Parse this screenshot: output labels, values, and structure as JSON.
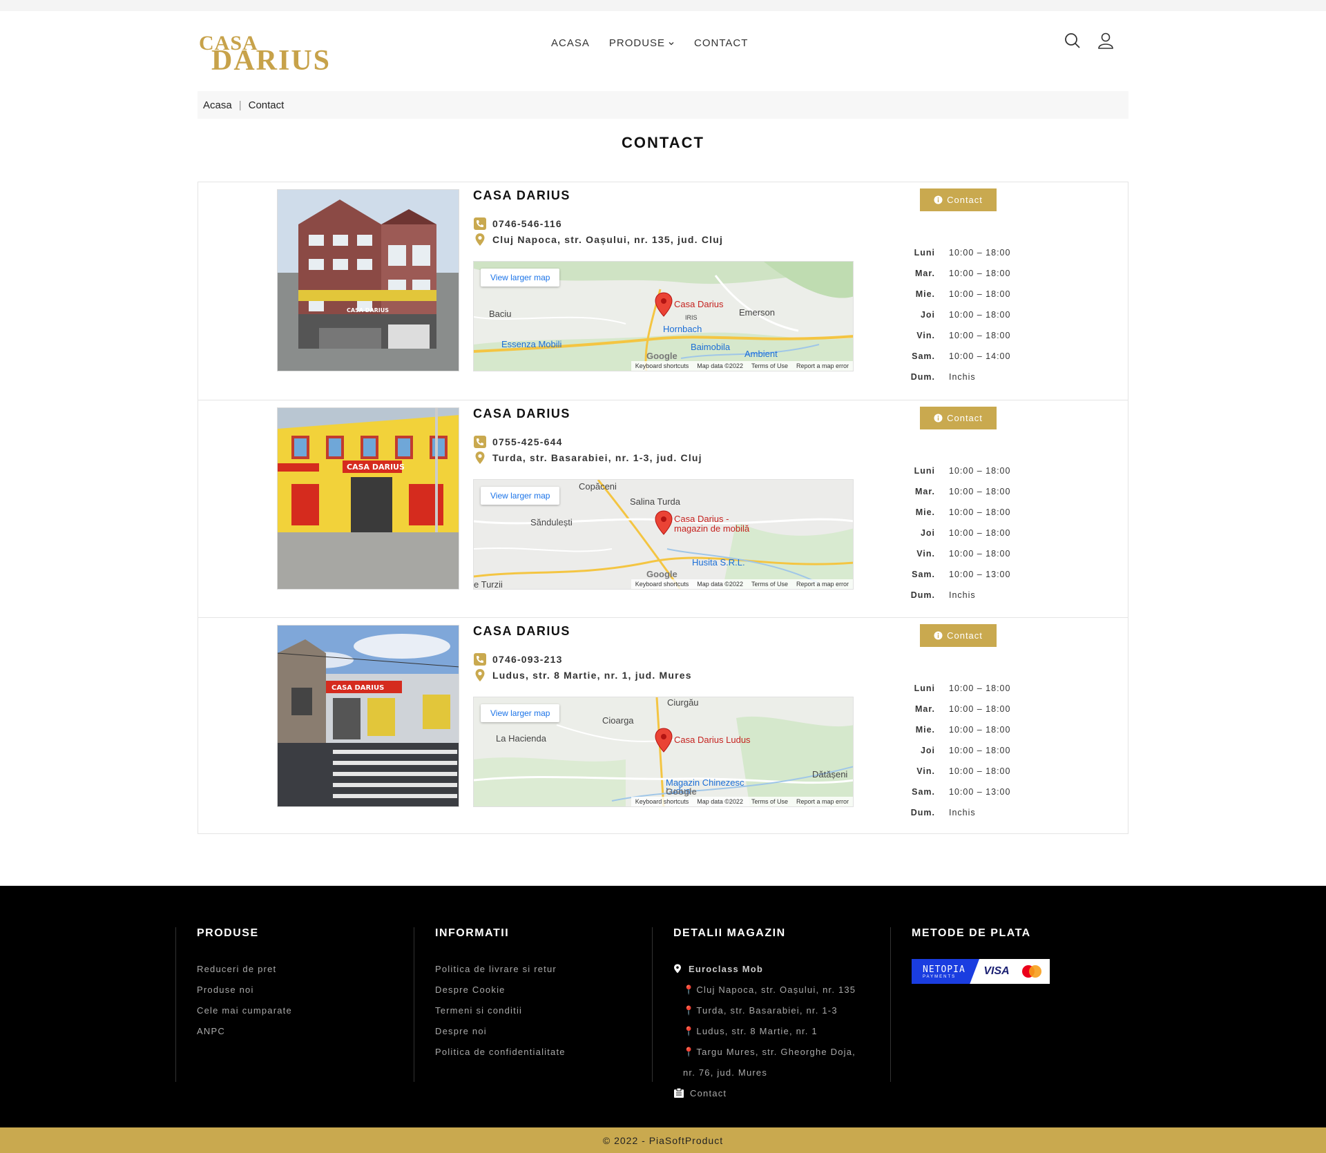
{
  "header": {
    "logo_top": "CASA",
    "logo_bottom": "DARIUS",
    "nav": [
      {
        "label": "ACASA"
      },
      {
        "label": "PRODUSE"
      },
      {
        "label": "CONTACT"
      }
    ]
  },
  "breadcrumb": {
    "home": "Acasa",
    "current": "Contact"
  },
  "page_title": "CONTACT",
  "stores": [
    {
      "name": "CASA DARIUS",
      "phone": "0746-546-116",
      "address": "Cluj Napoca, str. Oașului, nr. 135, jud. Cluj",
      "contact_label": "Contact",
      "map": {
        "view_larger": "View larger map",
        "pin_label": "Casa Darius",
        "places": [
          "Baciu",
          "Emerson",
          "Hornbach",
          "Essenza Mobili",
          "Baimobila",
          "Ambient",
          "IRIS"
        ],
        "footer": [
          "Keyboard shortcuts",
          "Map data ©2022",
          "Terms of Use",
          "Report a map error"
        ]
      },
      "hours": [
        {
          "day": "Luni",
          "time": "10:00 – 18:00"
        },
        {
          "day": "Mar.",
          "time": "10:00 – 18:00"
        },
        {
          "day": "Mie.",
          "time": "10:00 – 18:00"
        },
        {
          "day": "Joi",
          "time": "10:00 – 18:00"
        },
        {
          "day": "Vin.",
          "time": "10:00 – 18:00"
        },
        {
          "day": "Sam.",
          "time": "10:00 – 14:00"
        },
        {
          "day": "Dum.",
          "time": "Inchis"
        }
      ]
    },
    {
      "name": "CASA DARIUS",
      "phone": "0755-425-644",
      "address": "Turda, str. Basarabiei, nr. 1-3, jud. Cluj",
      "contact_label": "Contact",
      "map": {
        "view_larger": "View larger map",
        "pin_label": "Casa Darius - magazin de mobilă",
        "places": [
          "Copăceni",
          "Salina Turda",
          "Săndulești",
          "Husita S.R.L.",
          "e Turzii"
        ],
        "footer": [
          "Keyboard shortcuts",
          "Map data ©2022",
          "Terms of Use",
          "Report a map error"
        ]
      },
      "hours": [
        {
          "day": "Luni",
          "time": "10:00 – 18:00"
        },
        {
          "day": "Mar.",
          "time": "10:00 – 18:00"
        },
        {
          "day": "Mie.",
          "time": "10:00 – 18:00"
        },
        {
          "day": "Joi",
          "time": "10:00 – 18:00"
        },
        {
          "day": "Vin.",
          "time": "10:00 – 18:00"
        },
        {
          "day": "Sam.",
          "time": "10:00 – 13:00"
        },
        {
          "day": "Dum.",
          "time": "Inchis"
        }
      ]
    },
    {
      "name": "CASA DARIUS",
      "phone": "0746-093-213",
      "address": "Ludus, str. 8 Martie, nr. 1, jud. Mures",
      "contact_label": "Contact",
      "map": {
        "view_larger": "View larger map",
        "pin_label": "Casa Darius Ludus",
        "places": [
          "Ciurgău",
          "Cioarga",
          "La Hacienda",
          "Dătășeni",
          "Magazin Chinezesc Ludus"
        ],
        "footer": [
          "Keyboard shortcuts",
          "Map data ©2022",
          "Terms of Use",
          "Report a map error"
        ]
      },
      "hours": [
        {
          "day": "Luni",
          "time": "10:00 – 18:00"
        },
        {
          "day": "Mar.",
          "time": "10:00 – 18:00"
        },
        {
          "day": "Mie.",
          "time": "10:00 – 18:00"
        },
        {
          "day": "Joi",
          "time": "10:00 – 18:00"
        },
        {
          "day": "Vin.",
          "time": "10:00 – 18:00"
        },
        {
          "day": "Sam.",
          "time": "10:00 – 13:00"
        },
        {
          "day": "Dum.",
          "time": "Inchis"
        }
      ]
    }
  ],
  "footer": {
    "produse": {
      "title": "PRODUSE",
      "items": [
        "Reduceri de pret",
        "Produse noi",
        "Cele mai cumparate",
        "ANPC"
      ]
    },
    "informatii": {
      "title": "INFORMATII",
      "items": [
        "Politica de livrare si retur",
        "Despre Cookie",
        "Termeni si conditii",
        "Despre noi",
        "Politica de confidentialitate"
      ]
    },
    "detalii": {
      "title": "DETALII MAGAZIN",
      "company": "Euroclass Mob",
      "addresses": [
        "Cluj Napoca, str. Oașului, nr. 135",
        "Turda, str. Basarabiei, nr. 1-3",
        "Ludus, str. 8 Martie, nr. 1",
        "Targu Mures, str. Gheorghe Doja,",
        "nr. 76, jud. Mures"
      ],
      "contact": "Contact"
    },
    "plata": {
      "title": "METODE DE PLATA",
      "netopia": "NETOPIA",
      "netopia_sub": "PAYMENTS",
      "visa": "VISA"
    }
  },
  "copyright": "© 2022 - PiaSoftProduct",
  "colors": {
    "gold": "#c9a94f",
    "footer_bg": "#000000",
    "map_pin": "#ea4335"
  }
}
